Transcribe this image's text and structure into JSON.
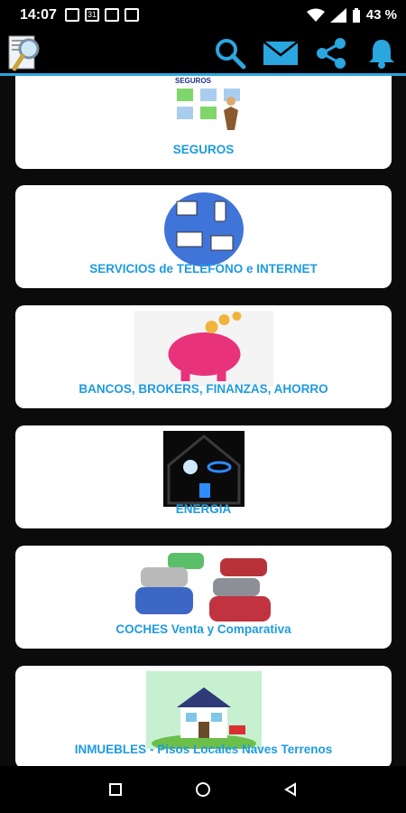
{
  "status": {
    "time": "14:07",
    "calendar_day": "31",
    "battery": "43 %"
  },
  "appbar": {
    "icons": [
      "search-icon",
      "mail-icon",
      "share-icon",
      "bell-icon"
    ],
    "accent": "#2aa6e0"
  },
  "categories": [
    {
      "label": "SEGUROS",
      "thumb_title": "SEGUROS"
    },
    {
      "label": "SERVICIOS de TELEFONO e INTERNET"
    },
    {
      "label": "BANCOS, BROKERS, FINANZAS, AHORRO"
    },
    {
      "label": "ENERGIA"
    },
    {
      "label": "COCHES Venta y Comparativa"
    },
    {
      "label": "INMUEBLES - Pisos Locales Naves Terrenos"
    }
  ],
  "colors": {
    "label": "#1e9be0",
    "card": "#ffffff",
    "background": "#000000"
  }
}
